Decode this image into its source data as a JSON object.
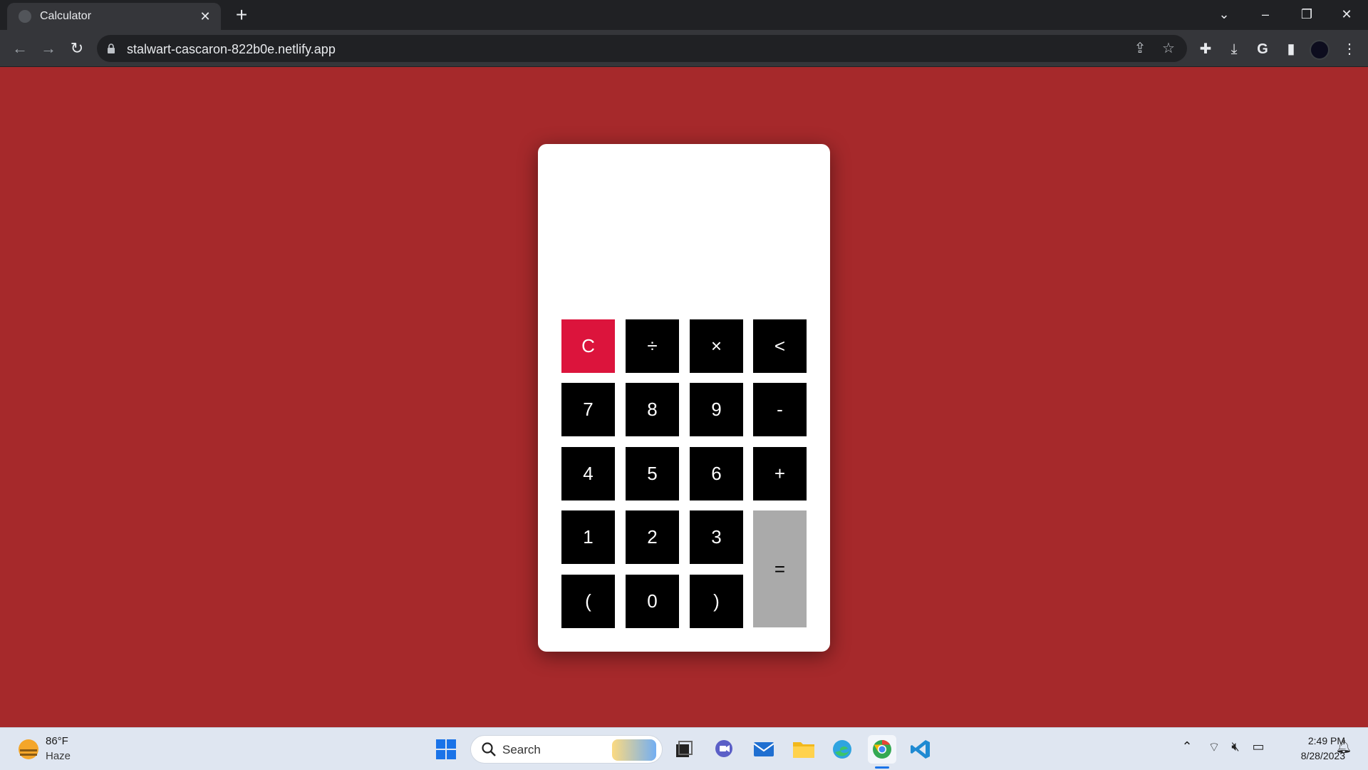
{
  "browser": {
    "tab_title": "Calculator",
    "tab_close": "✕",
    "new_tab": "+",
    "url": "stalwart-cascaron-822b0e.netlify.app",
    "window_controls": {
      "dropdown": "⌄",
      "minimize": "–",
      "restore": "❐",
      "close": "✕"
    },
    "nav": {
      "back": "←",
      "forward": "→",
      "reload": "↻"
    }
  },
  "calculator": {
    "display_value": "",
    "keys": [
      {
        "label": "C",
        "role": "clear"
      },
      {
        "label": "÷",
        "role": "operator"
      },
      {
        "label": "×",
        "role": "operator"
      },
      {
        "label": "<",
        "role": "backspace"
      },
      {
        "label": "7",
        "role": "digit"
      },
      {
        "label": "8",
        "role": "digit"
      },
      {
        "label": "9",
        "role": "digit"
      },
      {
        "label": "-",
        "role": "operator"
      },
      {
        "label": "4",
        "role": "digit"
      },
      {
        "label": "5",
        "role": "digit"
      },
      {
        "label": "6",
        "role": "digit"
      },
      {
        "label": "+",
        "role": "operator"
      },
      {
        "label": "1",
        "role": "digit"
      },
      {
        "label": "2",
        "role": "digit"
      },
      {
        "label": "3",
        "role": "digit"
      },
      {
        "label": "=",
        "role": "equals"
      },
      {
        "label": "(",
        "role": "paren"
      },
      {
        "label": "0",
        "role": "digit"
      },
      {
        "label": ")",
        "role": "paren"
      }
    ],
    "colors": {
      "page_background": "#a6292b",
      "key": "#000000",
      "clear": "#dc143c",
      "equals": "#aaaaaa"
    }
  },
  "taskbar": {
    "weather_temp": "86°F",
    "weather_desc": "Haze",
    "search_label": "Search",
    "time": "2:49 PM",
    "date": "8/28/2023",
    "apps": [
      "start-icon",
      "task-view-icon",
      "teams-chat-icon",
      "mail-icon",
      "file-explorer-icon",
      "edge-icon",
      "chrome-icon",
      "vscode-icon"
    ]
  }
}
